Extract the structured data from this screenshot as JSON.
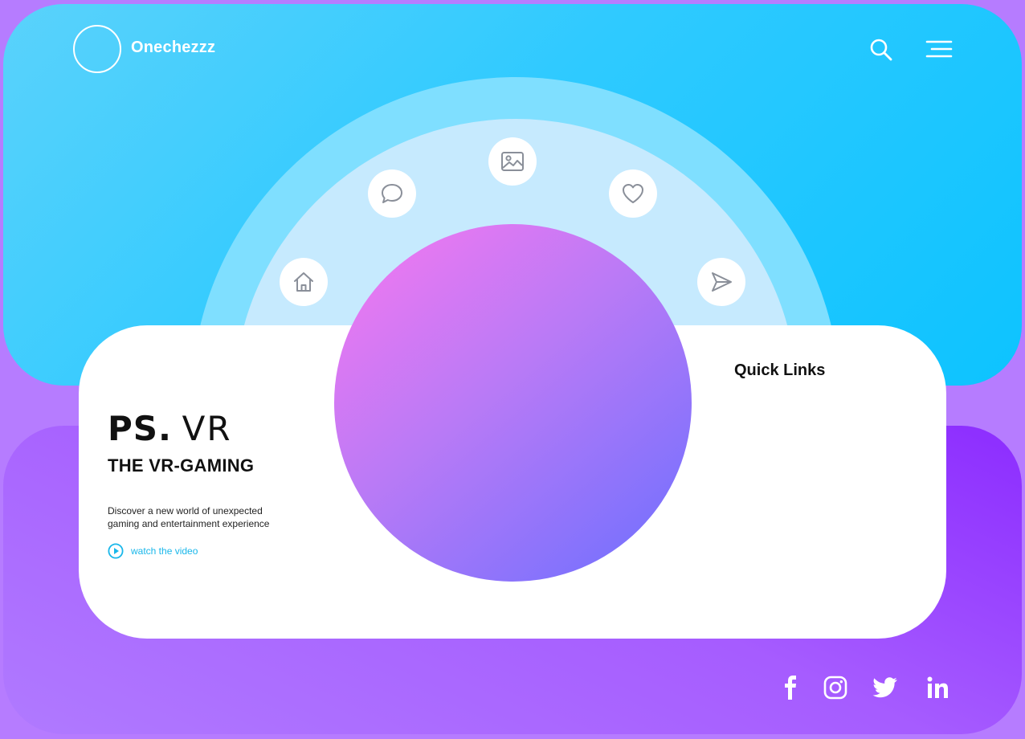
{
  "brand": {
    "name": "Onechezzz"
  },
  "header": {
    "icons": [
      "search-icon",
      "menu-icon"
    ]
  },
  "orbit_icons": [
    "home-icon",
    "chat-icon",
    "image-icon",
    "heart-icon",
    "send-icon"
  ],
  "hero": {
    "title_bold": "PS.",
    "title_light": "VR",
    "subtitle": "THE VR-GAMING",
    "description_line1": "Discover a new world of unexpected",
    "description_line2": "gaming and entertainment experience",
    "cta": "watch the video"
  },
  "quick_links": {
    "title": "Quick Links"
  },
  "social": [
    "facebook-icon",
    "instagram-icon",
    "twitter-icon",
    "linkedin-icon"
  ],
  "colors": {
    "page_background": "#b67cff",
    "top_panel": "#2fcaff",
    "outer_arc": "#7fdfff",
    "inner_arc": "#c6eafe",
    "bottom_panel": "#a65cff",
    "card": "#ffffff",
    "orb_start": "#f878f0",
    "orb_end": "#6b6fff",
    "accent": "#19b7ea",
    "icon_gray": "#8a8f99"
  }
}
